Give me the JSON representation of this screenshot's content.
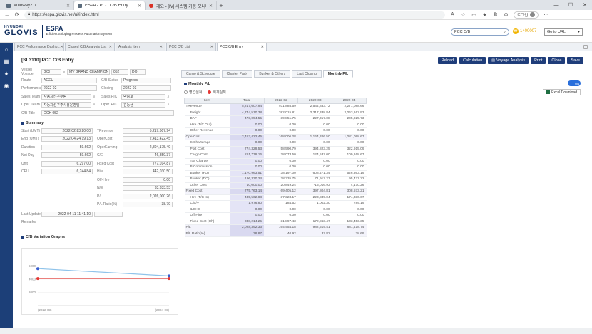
{
  "browser": {
    "tabs": [
      {
        "title": "Autoway2.0",
        "active": false
      },
      {
        "title": "ESPA - PCC C/B Entry",
        "active": true
      },
      {
        "title": "개요 - [IV] 시스템 가동 모니터링",
        "active": false
      }
    ],
    "url": "https://espa.glovis.net/ui/index.html",
    "profile_label": "로그인"
  },
  "header": {
    "logo_top": "HYUNDAI",
    "logo_main": "GLOVIS",
    "app_name": "ESPA",
    "app_subtitle": "Efficient Shipping Process Automation System",
    "search_value": "PCC C/B",
    "points": "1400007",
    "goto_label": "Go to URL"
  },
  "page_tabs": [
    {
      "label": "PCC Performance Dashb...",
      "active": false
    },
    {
      "label": "Closed C/B Analysis List",
      "active": false
    },
    {
      "label": "Analysis Item",
      "active": false
    },
    {
      "label": "PCC C/B List",
      "active": false
    },
    {
      "label": "PCC C/B Entry",
      "active": true
    }
  ],
  "page": {
    "title": "[SL3110] PCC C/B Entry",
    "actions": [
      "Reload",
      "Calculation",
      "Voyage Analysis",
      "Print",
      "Close",
      "Save"
    ]
  },
  "form": {
    "vessel_label": "Vessel Voyage",
    "vessel_code": "GCH",
    "vessel_name": "MV GRAND CHAMPION",
    "voyage_no": "052",
    "voyage_dir": "DO",
    "route_label": "Route",
    "route": "AGEU",
    "cb_status_label": "C/B Status",
    "cb_status": "Progress",
    "performance_label": "Performance",
    "performance": "2022-02",
    "closing_label": "Closing",
    "closing": "2022-03",
    "sales_team_label": "Sales Team",
    "sales_team": "자동차선구주팀",
    "sales_pic_label": "Sales PIC",
    "sales_pic": "박승호",
    "oper_team_label": "Oper. Team",
    "oper_team": "자동차선구주사용운영팀",
    "oper_pic_label": "Oper. PIC",
    "oper_pic": "김동균",
    "cb_title_label": "C/B Title",
    "cb_title": "GCH 052"
  },
  "summary": {
    "title": "Summary",
    "left": [
      {
        "label": "Start (UMT)",
        "value": "2022-02-23 20:00"
      },
      {
        "label": "End (UMT)",
        "value": "2022-04-24 19:13"
      },
      {
        "label": "Duration",
        "value": "59.662"
      },
      {
        "label": "Net Day",
        "value": "59.662"
      },
      {
        "label": "Unit",
        "value": "6,297.00"
      },
      {
        "label": "CEU",
        "value": "6,244.84"
      }
    ],
    "right": [
      {
        "label": "TRevenue",
        "value": "5,217,607.94"
      },
      {
        "label": "OperCost",
        "value": "2,413,422.45"
      },
      {
        "label": "OperEarning",
        "value": "2,804,175.49"
      },
      {
        "label": "C/E",
        "value": "46,859.37"
      },
      {
        "label": "Fixed Cost",
        "value": "777,014.87"
      },
      {
        "label": "Hire",
        "value": "442,030.50"
      },
      {
        "label": "Off-Hire",
        "value": "0.00"
      },
      {
        "label": "N/E",
        "value": "33,833.53"
      },
      {
        "label": "P/L",
        "value": "2,026,000.26"
      },
      {
        "label": "P/L Ratio(%)",
        "value": "38.79"
      }
    ],
    "last_update_label": "Last Update",
    "last_update": "2022-04-11 11:41:10",
    "last_update_by": "",
    "remarks_label": "Remarks"
  },
  "variation": {
    "title": "C/B Variation Graphs",
    "y_ticks": [
      "6000",
      "4000",
      "2000"
    ]
  },
  "chart_data": {
    "type": "line",
    "x": [
      "(2022-03)",
      "(2004-06)"
    ],
    "series": [
      {
        "name": "",
        "color": "#8fc3ea",
        "marker": "#3a5fd0",
        "values": [
          5600,
          4500
        ]
      },
      {
        "name": "",
        "color": "#e53935",
        "marker": "#e53935",
        "values": [
          4100,
          4100
        ]
      }
    ],
    "ylim": [
      0,
      8000
    ],
    "grid": true
  },
  "right_tabs": [
    "Cargo & Schedule",
    "Charter Party",
    "Bunker & Others",
    "Last Closing",
    "Monthly P/L"
  ],
  "monthly": {
    "title": "Monthly P/L",
    "toggle_label": "ON",
    "radio_1": "영업실적",
    "radio_2": "회계실적",
    "excel_label": "Excel Download",
    "columns": [
      "Item",
      "Total",
      "2022-02",
      "2022-03",
      "2022-04"
    ],
    "rows": [
      {
        "item": "TRevenue",
        "top": true,
        "hl": false,
        "values": [
          "5,217,607.94",
          "401,885.59",
          "2,544,833.72",
          "2,271,088.66"
        ]
      },
      {
        "item": "Freight",
        "top": false,
        "hl": false,
        "values": [
          "4,744,510.38",
          "382,015.81",
          "2,317,338.84",
          "2,063,162.93"
        ]
      },
      {
        "item": "BAF",
        "top": false,
        "hl": false,
        "values": [
          "473,094.55",
          "39,851.75",
          "227,317.08",
          "205,925.73"
        ]
      },
      {
        "item": "Hire (T/C Out)",
        "top": false,
        "hl": false,
        "values": [
          "0.00",
          "0.00",
          "0.00",
          "0.00"
        ]
      },
      {
        "item": "Other Revenue",
        "top": false,
        "hl": false,
        "values": [
          "0.00",
          "0.00",
          "0.00",
          "0.00"
        ]
      },
      {
        "item": "OperCost",
        "top": true,
        "hl": true,
        "values": [
          "2,413,422.45",
          "168,006.28",
          "1,164,326.50",
          "1,081,098.67"
        ]
      },
      {
        "item": "S.Charterage",
        "top": false,
        "hl": false,
        "values": [
          "0.00",
          "0.00",
          "0.00",
          "0.00"
        ]
      },
      {
        "item": "Port Cost",
        "top": false,
        "hl": false,
        "values": [
          "774,329.53",
          "58,590.79",
          "394,823.25",
          "322,915.09"
        ]
      },
      {
        "item": "Cargo Cost",
        "top": false,
        "hl": false,
        "values": [
          "261,779.16",
          "28,073.50",
          "124,537.00",
          "109,168.67"
        ]
      },
      {
        "item": "T/S Charge",
        "top": false,
        "hl": false,
        "values": [
          "0.00",
          "0.00",
          "0.00",
          "0.00"
        ]
      },
      {
        "item": "B.Commission",
        "top": false,
        "hl": false,
        "values": [
          "0.00",
          "0.00",
          "0.00",
          "0.00"
        ]
      },
      {
        "item": "Bunker (FO)",
        "top": false,
        "hl": false,
        "values": [
          "1,170,963.51",
          "38,197.00",
          "608,471.34",
          "526,363.19"
        ]
      },
      {
        "item": "Bunker (DO)",
        "top": false,
        "hl": false,
        "values": [
          "196,330.24",
          "28,335.75",
          "71,917.27",
          "95,477.22"
        ]
      },
      {
        "item": "Other Cost",
        "top": false,
        "hl": false,
        "values": [
          "10,000.00",
          "20,849.24",
          "-15,016.93",
          "4,170.26"
        ]
      },
      {
        "item": "Fixed Cost",
        "top": true,
        "hl": true,
        "values": [
          "775,763.14",
          "69,405.12",
          "397,804.81",
          "308,573.21"
        ]
      },
      {
        "item": "Hire (T/C In)",
        "top": false,
        "hl": false,
        "values": [
          "435,562.88",
          "37,323.17",
          "223,839.04",
          "174,330.67"
        ]
      },
      {
        "item": "C/E/V",
        "top": false,
        "hl": false,
        "values": [
          "1,976.80",
          "184.52",
          "1,002.30",
          "789.19"
        ]
      },
      {
        "item": "ILOHC",
        "top": false,
        "hl": false,
        "values": [
          "0.00",
          "0.00",
          "0.00",
          "0.00"
        ]
      },
      {
        "item": "Off-Hire",
        "top": false,
        "hl": false,
        "values": [
          "0.00",
          "0.00",
          "0.00",
          "0.00"
        ]
      },
      {
        "item": "Fixed Cost (Oh)",
        "top": false,
        "hl": false,
        "values": [
          "338,214.25",
          "31,897.43",
          "172,863.47",
          "133,453.35"
        ]
      },
      {
        "item": "P/L",
        "top": true,
        "hl": true,
        "values": [
          "2,028,392.33",
          "164,454.18",
          "982,519.41",
          "881,418.74"
        ]
      },
      {
        "item": "P/L Ratio(%)",
        "top": true,
        "hl": true,
        "values": [
          "38.87",
          "40.92",
          "37.82",
          "38.69"
        ]
      }
    ]
  }
}
